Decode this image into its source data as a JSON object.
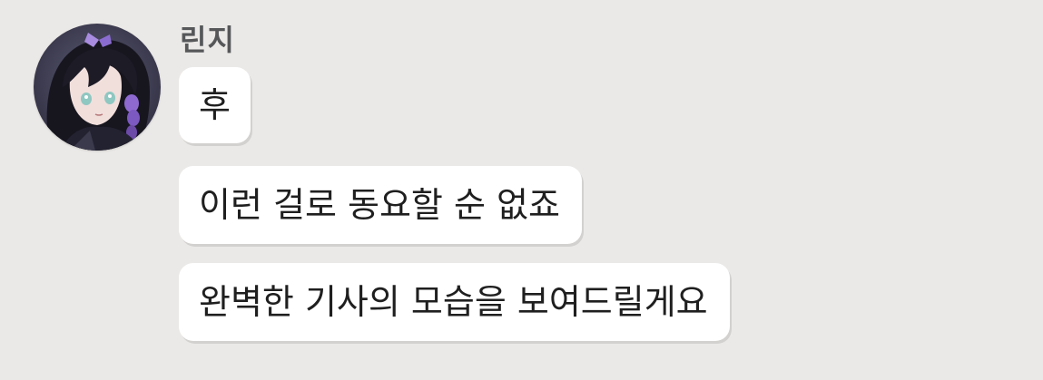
{
  "chat": {
    "sender": {
      "name": "린지",
      "avatar_icon": "anime-character-avatar-icon"
    },
    "messages": [
      {
        "text": "후"
      },
      {
        "text": "이런 걸로 동요할 순 없죠"
      },
      {
        "text": "완벽한 기사의 모습을 보여드릴게요"
      }
    ]
  },
  "colors": {
    "background": "#ebe9e7",
    "bubble": "#ffffff",
    "name_text": "#555759",
    "message_text": "#1f1f1f"
  }
}
